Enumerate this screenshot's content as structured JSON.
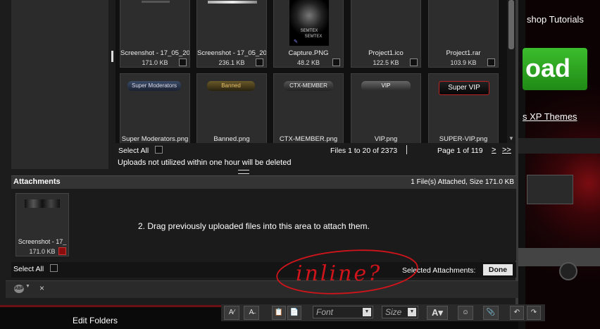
{
  "background": {
    "tutorials_text": "shop Tutorials",
    "download_text": "oad",
    "xp_themes_text": "s XP Themes"
  },
  "file_grid": {
    "rows": [
      [
        {
          "name": "Screenshot - 17_05_20",
          "size": "171.0 KB"
        },
        {
          "name": "Screenshot - 17_05_20",
          "size": "236.1 KB"
        },
        {
          "name": "Capture.PNG",
          "size": "48.2 KB"
        },
        {
          "name": "Project1.ico",
          "size": "122.5 KB"
        },
        {
          "name": "Project1.rar",
          "size": "103.9 KB"
        }
      ],
      [
        {
          "name": "Super Moderators.png",
          "badge": "Super Moderators"
        },
        {
          "name": "Banned.png",
          "badge": "Banned"
        },
        {
          "name": "CTX-MEMBER.png",
          "badge": "CTX-MEMBER"
        },
        {
          "name": "VIP.png",
          "badge": "VIP"
        },
        {
          "name": "SUPER-VIP.png",
          "badge": "Super VIP"
        }
      ]
    ],
    "capture_thumb_text": [
      "SEMTEX",
      "SEMTEX"
    ]
  },
  "pagination": {
    "select_all": "Select All",
    "files_range": "Files 1 to 20 of 2373",
    "page_indicator": "Page 1 of 119",
    "next": ">",
    "last": ">>"
  },
  "notice": "Uploads not utilized within one hour will be deleted",
  "attachments": {
    "title": "Attachments",
    "summary": "1 File(s) Attached, Size 171.0 KB",
    "item": {
      "name": "Screenshot - 17_",
      "size": "171.0 KB"
    },
    "drag_hint": "2. Drag previously uploaded files into this area to attach them.",
    "select_all": "Select All",
    "selected_label": "Selected Attachments:",
    "done_label": "Done"
  },
  "annotation": {
    "text": "inline?",
    "color": "#d0141b"
  },
  "status_bar": {
    "abp_label": "ABP",
    "close": "×"
  },
  "sidebar": {
    "edit_folders": "Edit Folders"
  },
  "editor_toolbar": {
    "font_placeholder": "Font",
    "size_placeholder": "Size"
  },
  "colors": {
    "accent_red": "#6a1015",
    "panel_bg": "#1c1c1c",
    "download_green": "#2ea321"
  }
}
